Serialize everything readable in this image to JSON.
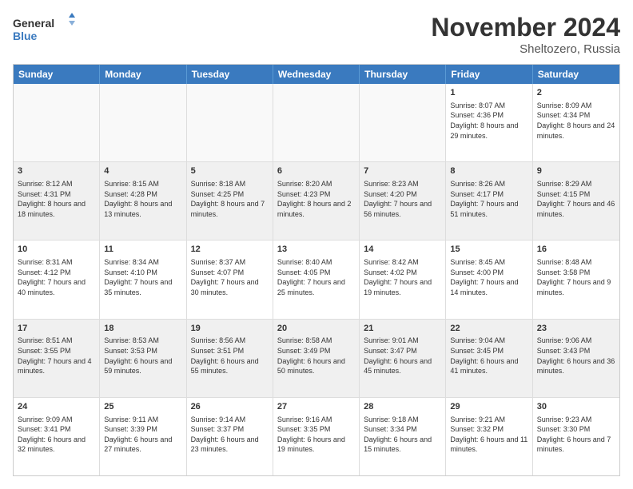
{
  "logo": {
    "line1": "General",
    "line2": "Blue"
  },
  "title": "November 2024",
  "location": "Sheltozero, Russia",
  "header_days": [
    "Sunday",
    "Monday",
    "Tuesday",
    "Wednesday",
    "Thursday",
    "Friday",
    "Saturday"
  ],
  "rows": [
    [
      {
        "day": "",
        "info": "",
        "shaded": true
      },
      {
        "day": "",
        "info": "",
        "shaded": true
      },
      {
        "day": "",
        "info": "",
        "shaded": true
      },
      {
        "day": "",
        "info": "",
        "shaded": true
      },
      {
        "day": "",
        "info": "",
        "shaded": true
      },
      {
        "day": "1",
        "info": "Sunrise: 8:07 AM\nSunset: 4:36 PM\nDaylight: 8 hours and 29 minutes.",
        "shaded": false
      },
      {
        "day": "2",
        "info": "Sunrise: 8:09 AM\nSunset: 4:34 PM\nDaylight: 8 hours and 24 minutes.",
        "shaded": false
      }
    ],
    [
      {
        "day": "3",
        "info": "Sunrise: 8:12 AM\nSunset: 4:31 PM\nDaylight: 8 hours and 18 minutes.",
        "shaded": true
      },
      {
        "day": "4",
        "info": "Sunrise: 8:15 AM\nSunset: 4:28 PM\nDaylight: 8 hours and 13 minutes.",
        "shaded": true
      },
      {
        "day": "5",
        "info": "Sunrise: 8:18 AM\nSunset: 4:25 PM\nDaylight: 8 hours and 7 minutes.",
        "shaded": true
      },
      {
        "day": "6",
        "info": "Sunrise: 8:20 AM\nSunset: 4:23 PM\nDaylight: 8 hours and 2 minutes.",
        "shaded": true
      },
      {
        "day": "7",
        "info": "Sunrise: 8:23 AM\nSunset: 4:20 PM\nDaylight: 7 hours and 56 minutes.",
        "shaded": true
      },
      {
        "day": "8",
        "info": "Sunrise: 8:26 AM\nSunset: 4:17 PM\nDaylight: 7 hours and 51 minutes.",
        "shaded": true
      },
      {
        "day": "9",
        "info": "Sunrise: 8:29 AM\nSunset: 4:15 PM\nDaylight: 7 hours and 46 minutes.",
        "shaded": true
      }
    ],
    [
      {
        "day": "10",
        "info": "Sunrise: 8:31 AM\nSunset: 4:12 PM\nDaylight: 7 hours and 40 minutes.",
        "shaded": false
      },
      {
        "day": "11",
        "info": "Sunrise: 8:34 AM\nSunset: 4:10 PM\nDaylight: 7 hours and 35 minutes.",
        "shaded": false
      },
      {
        "day": "12",
        "info": "Sunrise: 8:37 AM\nSunset: 4:07 PM\nDaylight: 7 hours and 30 minutes.",
        "shaded": false
      },
      {
        "day": "13",
        "info": "Sunrise: 8:40 AM\nSunset: 4:05 PM\nDaylight: 7 hours and 25 minutes.",
        "shaded": false
      },
      {
        "day": "14",
        "info": "Sunrise: 8:42 AM\nSunset: 4:02 PM\nDaylight: 7 hours and 19 minutes.",
        "shaded": false
      },
      {
        "day": "15",
        "info": "Sunrise: 8:45 AM\nSunset: 4:00 PM\nDaylight: 7 hours and 14 minutes.",
        "shaded": false
      },
      {
        "day": "16",
        "info": "Sunrise: 8:48 AM\nSunset: 3:58 PM\nDaylight: 7 hours and 9 minutes.",
        "shaded": false
      }
    ],
    [
      {
        "day": "17",
        "info": "Sunrise: 8:51 AM\nSunset: 3:55 PM\nDaylight: 7 hours and 4 minutes.",
        "shaded": true
      },
      {
        "day": "18",
        "info": "Sunrise: 8:53 AM\nSunset: 3:53 PM\nDaylight: 6 hours and 59 minutes.",
        "shaded": true
      },
      {
        "day": "19",
        "info": "Sunrise: 8:56 AM\nSunset: 3:51 PM\nDaylight: 6 hours and 55 minutes.",
        "shaded": true
      },
      {
        "day": "20",
        "info": "Sunrise: 8:58 AM\nSunset: 3:49 PM\nDaylight: 6 hours and 50 minutes.",
        "shaded": true
      },
      {
        "day": "21",
        "info": "Sunrise: 9:01 AM\nSunset: 3:47 PM\nDaylight: 6 hours and 45 minutes.",
        "shaded": true
      },
      {
        "day": "22",
        "info": "Sunrise: 9:04 AM\nSunset: 3:45 PM\nDaylight: 6 hours and 41 minutes.",
        "shaded": true
      },
      {
        "day": "23",
        "info": "Sunrise: 9:06 AM\nSunset: 3:43 PM\nDaylight: 6 hours and 36 minutes.",
        "shaded": true
      }
    ],
    [
      {
        "day": "24",
        "info": "Sunrise: 9:09 AM\nSunset: 3:41 PM\nDaylight: 6 hours and 32 minutes.",
        "shaded": false
      },
      {
        "day": "25",
        "info": "Sunrise: 9:11 AM\nSunset: 3:39 PM\nDaylight: 6 hours and 27 minutes.",
        "shaded": false
      },
      {
        "day": "26",
        "info": "Sunrise: 9:14 AM\nSunset: 3:37 PM\nDaylight: 6 hours and 23 minutes.",
        "shaded": false
      },
      {
        "day": "27",
        "info": "Sunrise: 9:16 AM\nSunset: 3:35 PM\nDaylight: 6 hours and 19 minutes.",
        "shaded": false
      },
      {
        "day": "28",
        "info": "Sunrise: 9:18 AM\nSunset: 3:34 PM\nDaylight: 6 hours and 15 minutes.",
        "shaded": false
      },
      {
        "day": "29",
        "info": "Sunrise: 9:21 AM\nSunset: 3:32 PM\nDaylight: 6 hours and 11 minutes.",
        "shaded": false
      },
      {
        "day": "30",
        "info": "Sunrise: 9:23 AM\nSunset: 3:30 PM\nDaylight: 6 hours and 7 minutes.",
        "shaded": false
      }
    ]
  ]
}
